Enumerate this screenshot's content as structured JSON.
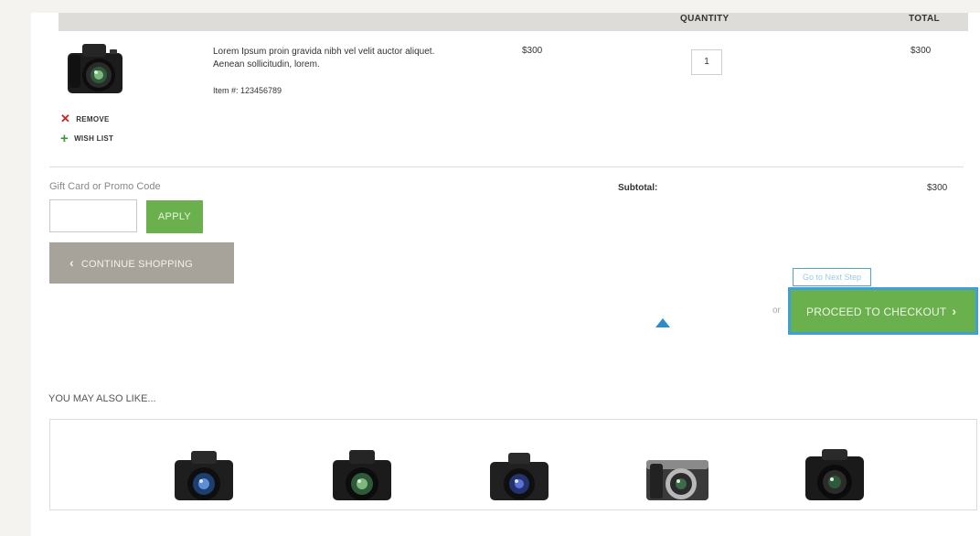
{
  "cart_table": {
    "columns": [
      "QUANTITY",
      "TOTAL"
    ]
  },
  "item": {
    "image": "camera-dslr",
    "description": "Lorem Ipsum proin gravida nibh vel velit auctor aliquet. Aenean sollicitudin, lorem.",
    "item_number": "Item #: 123456789",
    "price": "$300",
    "quantity": "1",
    "total": "$300",
    "remove_label": "REMOVE",
    "wishlist_label": "WISH LIST"
  },
  "promo": {
    "label": "Gift Card or Promo Code",
    "input_value": "",
    "apply_label": "APPLY"
  },
  "continue_label": "CONTINUE SHOPPING",
  "summary": {
    "subtotal_label": "Subtotal:",
    "subtotal_value": "$300"
  },
  "checkout": {
    "tooltip": "Go to Next Step",
    "or_text": "or",
    "button_label": "PROCEED TO CHECKOUT"
  },
  "related": {
    "heading": "YOU MAY ALSO LIKE...",
    "products": [
      {
        "image": "camera-dslr-blue-lens"
      },
      {
        "image": "camera-dslr-green-lens"
      },
      {
        "image": "camera-mirrorless-blue-lens"
      },
      {
        "image": "camera-compact-silver"
      },
      {
        "image": "camera-bridge-black"
      }
    ]
  },
  "colors": {
    "accent_green": "#6ab04c",
    "focus_blue": "#3fa0d6",
    "remove_red": "#cc2222",
    "continue_gray": "#a7a39b"
  }
}
